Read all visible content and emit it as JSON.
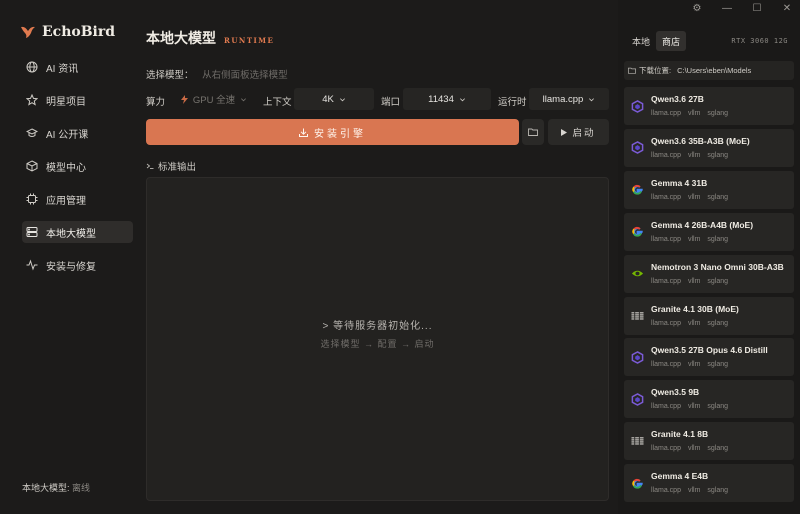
{
  "brand": {
    "name": "EchoBird"
  },
  "sidebar": {
    "items": [
      {
        "label": "AI 资讯",
        "icon": "globe-icon"
      },
      {
        "label": "明星项目",
        "icon": "star-icon"
      },
      {
        "label": "AI 公开课",
        "icon": "graduation-cap-icon"
      },
      {
        "label": "模型中心",
        "icon": "cube-icon"
      },
      {
        "label": "应用管理",
        "icon": "chip-icon"
      },
      {
        "label": "本地大模型",
        "icon": "server-icon",
        "active": true
      },
      {
        "label": "安装与修复",
        "icon": "pulse-icon"
      }
    ],
    "footer": {
      "label": "本地大模型:",
      "value": "离线"
    }
  },
  "page": {
    "title": "本地大模型",
    "subtitle": "RUNTIME"
  },
  "model_select": {
    "label": "选择模型：",
    "hint": "从右侧面板选择模型"
  },
  "config": {
    "compute_label": "算力",
    "compute_value": "GPU 全速",
    "context_label": "上下文",
    "context_value": "4K",
    "port_label": "端口",
    "port_value": "11434",
    "runtime_label": "运行时",
    "runtime_value": "llama.cpp"
  },
  "actions": {
    "install": "安装引擎",
    "start": "启动"
  },
  "console": {
    "label": "标准输出",
    "message": "> 等待服务器初始化...",
    "steps": "选择模型 → 配置 → 启动"
  },
  "right_panel": {
    "tabs": [
      "本地",
      "商店"
    ],
    "active_tab": "商店",
    "gpu": "RTX 3060 12G",
    "download_label": "下载位置:",
    "download_path": "C:\\Users\\eben\\Models",
    "models": [
      {
        "name": "Qwen3.6 27B",
        "tags": [
          "llama.cpp",
          "vllm",
          "sglang"
        ],
        "logo": "qwen-icon"
      },
      {
        "name": "Qwen3.6 35B-A3B (MoE)",
        "tags": [
          "llama.cpp",
          "vllm",
          "sglang"
        ],
        "logo": "qwen-icon"
      },
      {
        "name": "Gemma 4 31B",
        "tags": [
          "llama.cpp",
          "vllm",
          "sglang"
        ],
        "logo": "google-icon"
      },
      {
        "name": "Gemma 4 26B-A4B (MoE)",
        "tags": [
          "llama.cpp",
          "vllm",
          "sglang"
        ],
        "logo": "google-icon"
      },
      {
        "name": "Nemotron 3 Nano Omni 30B-A3B",
        "tags": [
          "llama.cpp",
          "vllm",
          "sglang"
        ],
        "logo": "nvidia-icon"
      },
      {
        "name": "Granite 4.1 30B (MoE)",
        "tags": [
          "llama.cpp",
          "vllm",
          "sglang"
        ],
        "logo": "ibm-icon"
      },
      {
        "name": "Qwen3.5 27B Opus 4.6 Distill",
        "tags": [
          "llama.cpp",
          "vllm",
          "sglang"
        ],
        "logo": "qwen-icon"
      },
      {
        "name": "Qwen3.5 9B",
        "tags": [
          "llama.cpp",
          "vllm",
          "sglang"
        ],
        "logo": "qwen-icon"
      },
      {
        "name": "Granite 4.1 8B",
        "tags": [
          "llama.cpp",
          "vllm",
          "sglang"
        ],
        "logo": "ibm-icon"
      },
      {
        "name": "Gemma 4 E4B",
        "tags": [
          "llama.cpp",
          "vllm",
          "sglang"
        ],
        "logo": "google-icon"
      }
    ]
  },
  "colors": {
    "accent": "#d97651",
    "background": "#1c1b1a",
    "panel": "#272624"
  }
}
